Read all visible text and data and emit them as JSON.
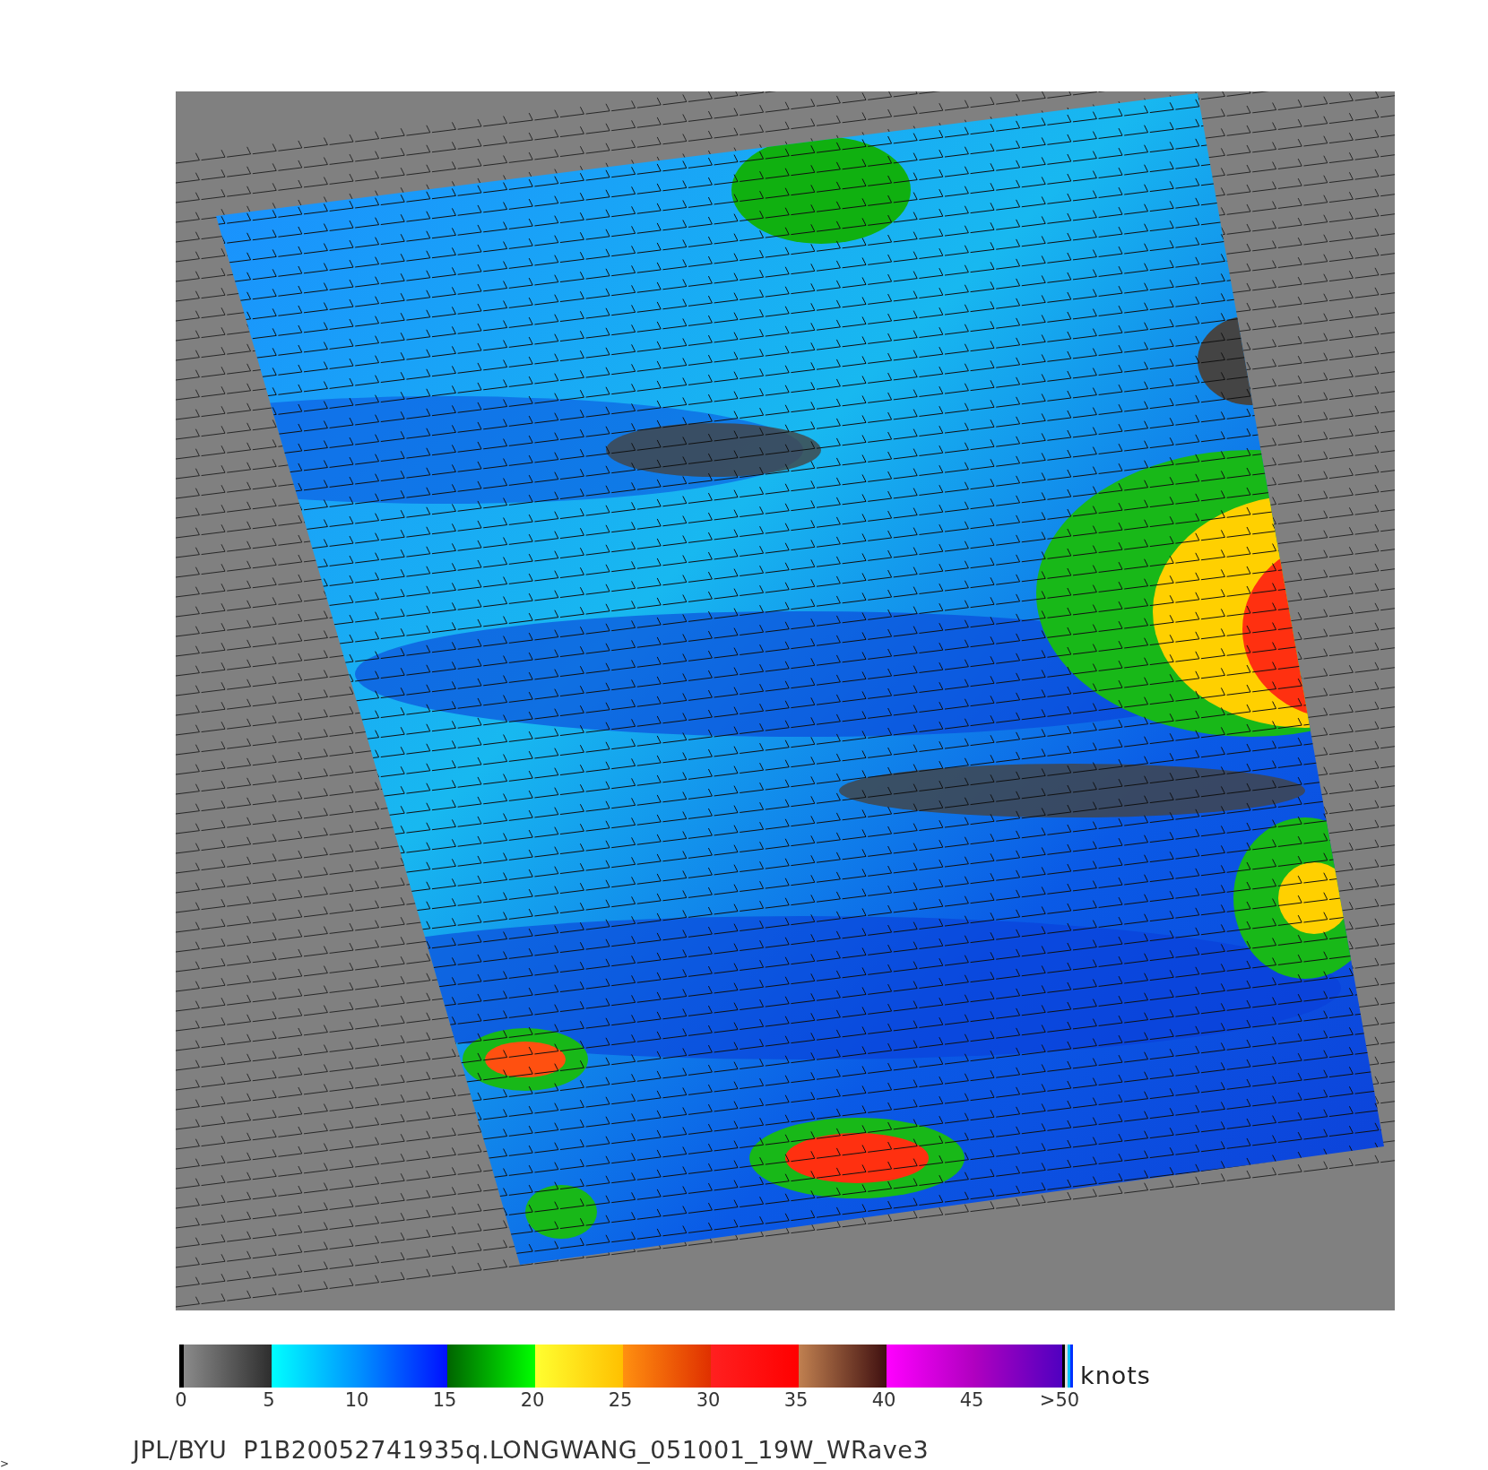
{
  "colorbar": {
    "ticks": [
      "0",
      "5",
      "10",
      "15",
      "20",
      "25",
      "30",
      "35",
      "40",
      "45",
      ">50"
    ],
    "unit": "knots"
  },
  "caption": "JPL/BYU  P1B20052741935q.LONGWANG_051001_19W_WRave3",
  "edge_mark": ">"
}
